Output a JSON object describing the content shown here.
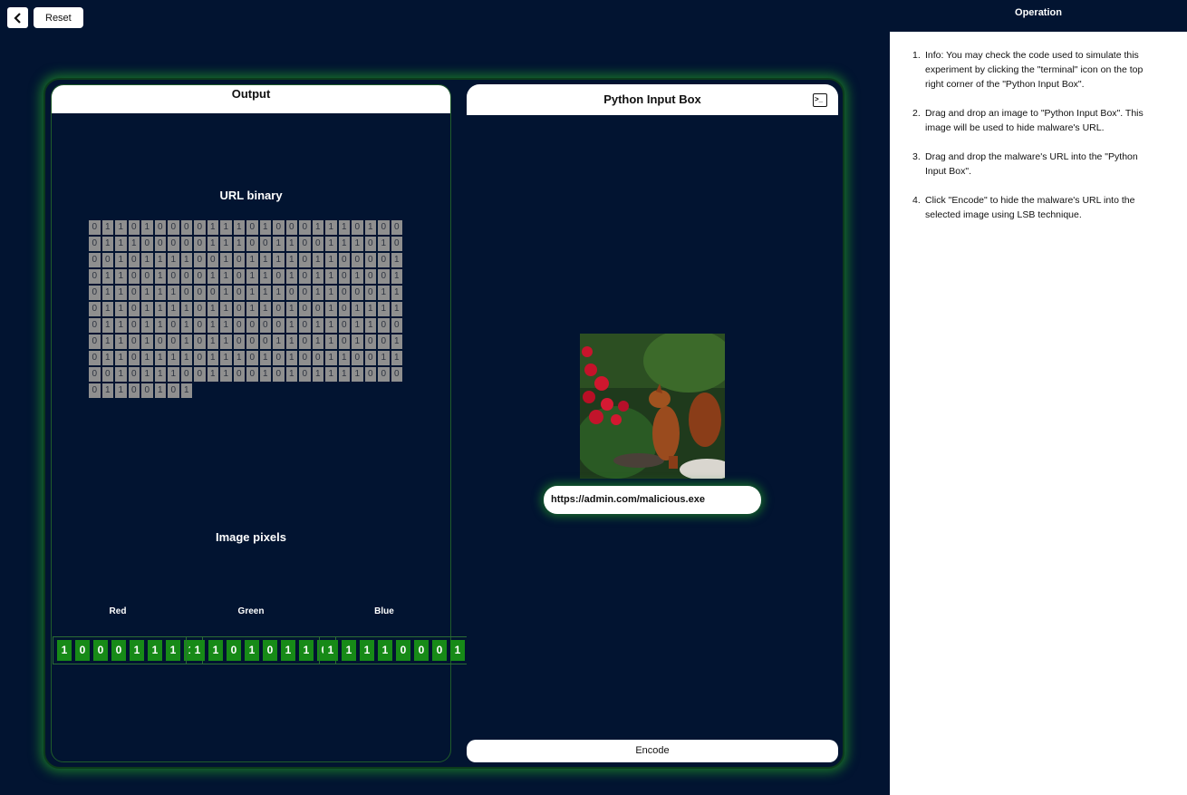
{
  "topbar": {
    "back_icon": "chevron-left-icon",
    "reset_label": "Reset"
  },
  "output_panel": {
    "title": "Output",
    "url_binary_title": "URL binary",
    "url_binary_rows": [
      "011010000111010001110100",
      "011100000111001100111010",
      "001011110010111101100001",
      "011001000110110101101001",
      "011011100010111001100011",
      "011011110110110100101111",
      "011011010110000101101100",
      "011010010110001101101001",
      "011011110111010100110011",
      "001011100110010101111000",
      "01100101"
    ],
    "image_pixels_title": "Image pixels",
    "pixels": [
      {
        "label": "Red",
        "bits": "10001111"
      },
      {
        "label": "Green",
        "bits": "11010110"
      },
      {
        "label": "Blue",
        "bits": "11110001"
      }
    ]
  },
  "input_panel": {
    "title": "Python Input Box",
    "terminal_icon": "terminal-icon",
    "url_chip": "https://admin.com/malicious.exe",
    "encode_label": "Encode"
  },
  "sidebar": {
    "title": "Operation",
    "steps": [
      "Info: You may check the code used to simulate this experiment by clicking the \"terminal\" icon on the top right corner of the \"Python Input Box\".",
      "Drag and drop an image to \"Python Input Box\". This image will be used to hide malware's URL.",
      "Drag and drop the malware's URL into the \"Python Input Box\".",
      "Click \"Encode\" to hide the malware's URL into the selected image using LSB technique."
    ]
  }
}
